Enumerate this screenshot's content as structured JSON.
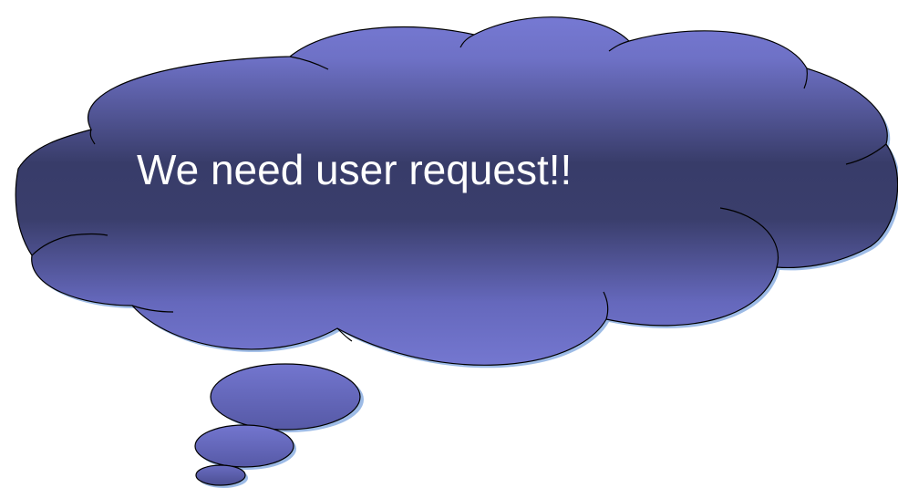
{
  "thought_bubble": {
    "text": "We need user request!!",
    "colors": {
      "fill_light": "#7477d0",
      "fill_dark": "#363a66",
      "outline": "#000000",
      "shadow": "#9dbbe6",
      "text": "#ffffff"
    }
  }
}
